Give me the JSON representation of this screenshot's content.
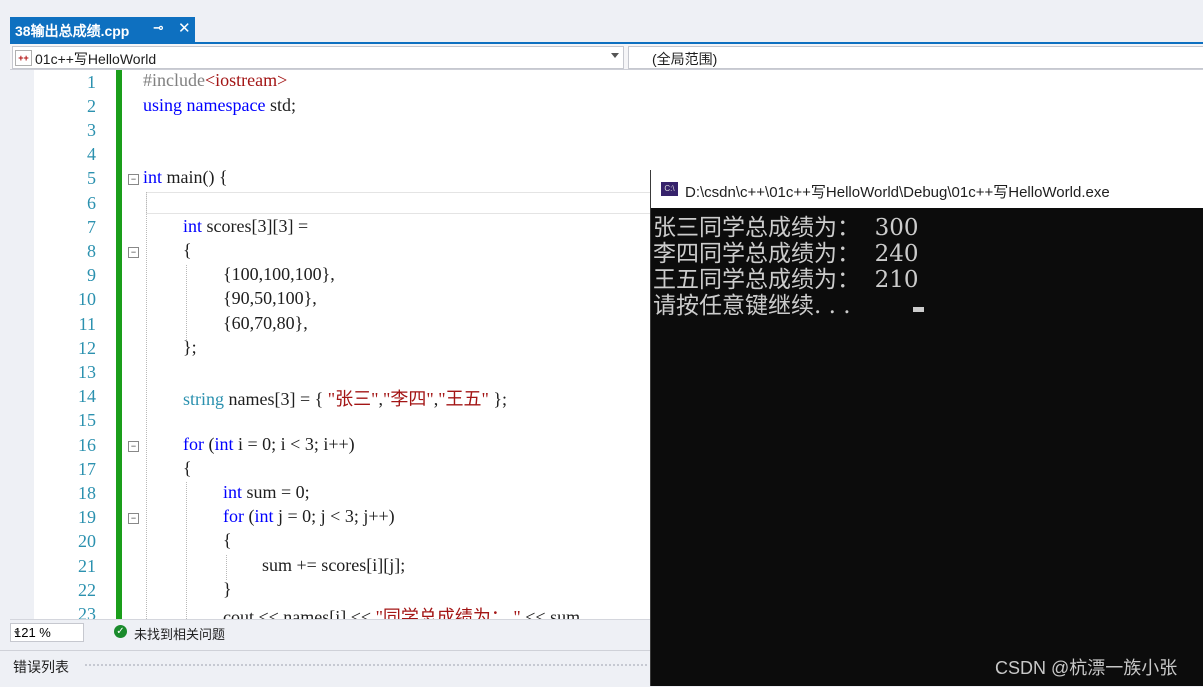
{
  "tab": {
    "title": "38输出总成绩.cpp",
    "pin": "⊸",
    "close": "✕"
  },
  "navbar": {
    "project": "01c++写HelloWorld",
    "scope": "(全局范围)",
    "project_icon": "c++ project icon"
  },
  "editor": {
    "line_numbers": [
      "1",
      "2",
      "3",
      "4",
      "5",
      "6",
      "7",
      "8",
      "9",
      "10",
      "11",
      "12",
      "13",
      "14",
      "15",
      "16",
      "17",
      "18",
      "19",
      "20",
      "21",
      "22",
      "23"
    ],
    "code": {
      "l1_a": "#include",
      "l1_b": "<iostream>",
      "l2_a": "using",
      "l2_b": "namespace",
      "l2_c": "std;",
      "l5_a": "int",
      "l5_b": "main() {",
      "l7_a": "int",
      "l7_b": "scores[3][3] =",
      "l8": "{",
      "l9": "{100,100,100},",
      "l10": "{90,50,100},",
      "l11": "{60,70,80},",
      "l12": "};",
      "l14_a": "string",
      "l14_b": "names[3] = {",
      "l14_c": "\"张三\"",
      "l14_d": ",",
      "l14_e": "\"李四\"",
      "l14_f": ",",
      "l14_g": "\"王五\"",
      "l14_h": " };",
      "l16_a": "for",
      "l16_b": "(",
      "l16_c": "int",
      "l16_d": "i = 0; i < 3; i++)",
      "l17": "{",
      "l18_a": "int",
      "l18_b": "sum = 0;",
      "l19_a": "for",
      "l19_b": "(",
      "l19_c": "int",
      "l19_d": "j = 0; j < 3; j++)",
      "l20": "{",
      "l21": "sum += scores[i][j];",
      "l22": "}",
      "l23_a": "cout << names[i] << ",
      "l23_b": "\"同学总成绩为： \"",
      "l23_c": " << sum"
    }
  },
  "status": {
    "zoom": "121 %",
    "issues": "未找到相关问题"
  },
  "error_panel": {
    "title": "错误列表"
  },
  "console": {
    "title": "D:\\csdn\\c++\\01c++写HelloWorld\\Debug\\01c++写HelloWorld.exe",
    "icon_text": "C:\\",
    "lines": [
      "张三同学总成绩为：  300",
      "李四同学总成绩为：  240",
      "王五同学总成绩为：  210",
      "请按任意键继续. . . "
    ]
  },
  "watermark": "CSDN @杭漂一族小张",
  "colors": {
    "accent": "#0e70c0",
    "change_bar": "#1a9e1a",
    "keyword": "#0000ff",
    "type": "#2b91af",
    "string": "#a31515",
    "console_bg": "#0c0c0c"
  }
}
